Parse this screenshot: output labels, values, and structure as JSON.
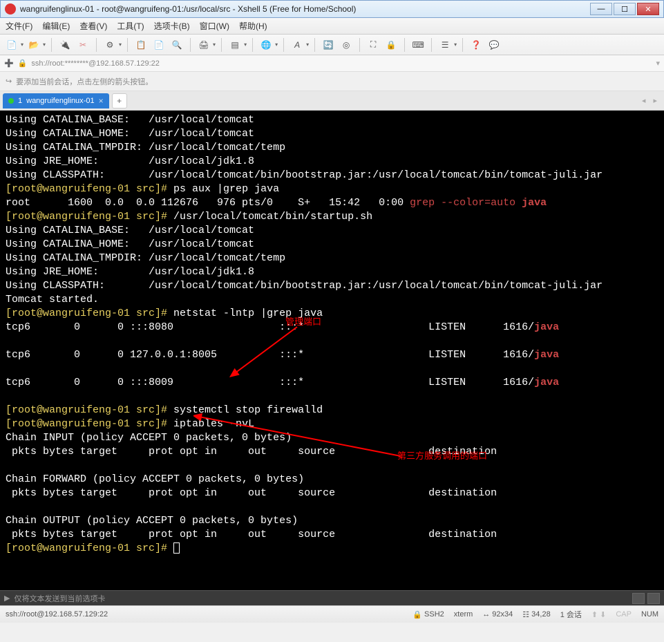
{
  "window": {
    "title": "wangruifenglinux-01 - root@wangruifeng-01:/usr/local/src - Xshell 5 (Free for Home/School)"
  },
  "menus": [
    "文件(F)",
    "编辑(E)",
    "查看(V)",
    "工具(T)",
    "选项卡(B)",
    "窗口(W)",
    "帮助(H)"
  ],
  "address": "ssh://root:********@192.168.57.129:22",
  "hint": "要添加当前会话，点击左侧的箭头按钮。",
  "tab": {
    "index": "1",
    "label": "wangruifenglinux-01"
  },
  "annotations": {
    "a1": "管理端口",
    "a2": "第三方服务调用的端口"
  },
  "inputbar_hint": "仅将文本发送到当前选项卡",
  "status": {
    "conn": "ssh://root@192.168.57.129:22",
    "ssh": "SSH2",
    "term": "xterm",
    "size": "92x34",
    "pos": "34,28",
    "sessions": "1 会话",
    "cap": "CAP",
    "num": "NUM"
  },
  "term": {
    "l1": "Using CATALINA_BASE:   /usr/local/tomcat",
    "l2": "Using CATALINA_HOME:   /usr/local/tomcat",
    "l3": "Using CATALINA_TMPDIR: /usr/local/tomcat/temp",
    "l4": "Using JRE_HOME:        /usr/local/jdk1.8",
    "l5": "Using CLASSPATH:       /usr/local/tomcat/bin/bootstrap.jar:/usr/local/tomcat/bin/tomcat-juli.jar",
    "p1a": "[root@wangruifeng-01 src]# ",
    "p1b": "ps aux |grep java",
    "l7": "root      1600  0.0  0.0 112676   976 pts/0    S+   15:42   0:00 ",
    "l7grep": "grep --color=auto",
    "l7sp": " ",
    "l7java": "java",
    "p2b": "/usr/local/tomcat/bin/startup.sh",
    "l9": "Using CATALINA_BASE:   /usr/local/tomcat",
    "l10": "Using CATALINA_HOME:   /usr/local/tomcat",
    "l11": "Using CATALINA_TMPDIR: /usr/local/tomcat/temp",
    "l12": "Using JRE_HOME:        /usr/local/jdk1.8",
    "l13": "Using CLASSPATH:       /usr/local/tomcat/bin/bootstrap.jar:/usr/local/tomcat/bin/tomcat-juli.jar",
    "l14": "Tomcat started.",
    "p3b": "netstat -lntp |grep java",
    "n1a": "tcp6       0      0 :::8080                 :::*                    LISTEN      1616/",
    "java": "java",
    "n2a": "tcp6       0      0 127.0.0.1:8005          :::*                    LISTEN      1616/",
    "n3a": "tcp6       0      0 :::8009                 :::*                    LISTEN      1616/",
    "p4b": "systemctl stop firewalld",
    "p5b": "iptables -nvL",
    "c1": "Chain INPUT (policy ACCEPT 0 packets, 0 bytes)",
    "hdr": " pkts bytes target     prot opt in     out     source               destination",
    "c2": "Chain FORWARD (policy ACCEPT 0 packets, 0 bytes)",
    "c3": "Chain OUTPUT (policy ACCEPT 0 packets, 0 bytes)",
    "pend": "[root@wangruifeng-01 src]# "
  }
}
